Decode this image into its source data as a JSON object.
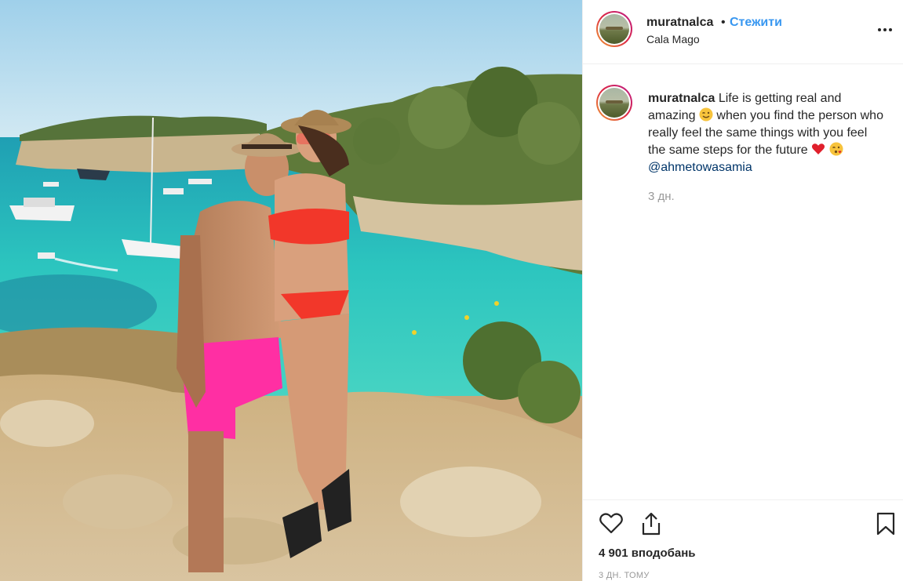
{
  "post": {
    "photo_alt": "",
    "colors": {
      "sky": "#b9dcee",
      "sea": "#2fc2bf",
      "deep_sea": "#1f8fa8",
      "cliff": "#d9c9a6",
      "trees": "#5f7a3a",
      "rock": "#d7c39c",
      "swimshorts": "#ff2fa3",
      "bikini": "#f2372a"
    }
  },
  "header": {
    "username": "muratnalca",
    "separator": "•",
    "follow_label": "Стежити",
    "location": "Cala Mago",
    "more_icon": "more-horizontal-icon"
  },
  "caption": {
    "username": "muratnalca",
    "text_part1": "Life is getting real and amazing",
    "emoji1": "winking-face",
    "text_part2": "when you find the person who really feel the same things with you feel the same steps for the future",
    "emoji2": "red-heart",
    "emoji3": "face-blowing-kiss",
    "mention": "@ahmetowasamia",
    "time": "3 дн."
  },
  "actions": {
    "like_icon": "heart-outline-icon",
    "share_icon": "share-upload-icon",
    "save_icon": "bookmark-icon",
    "likes": "4 901 вподобань",
    "posted_ago": "3 ДН. ТОМУ"
  },
  "colors": {
    "accent_link": "#3897f0",
    "text": "#262626",
    "muted": "#999999",
    "border": "#efefef"
  }
}
